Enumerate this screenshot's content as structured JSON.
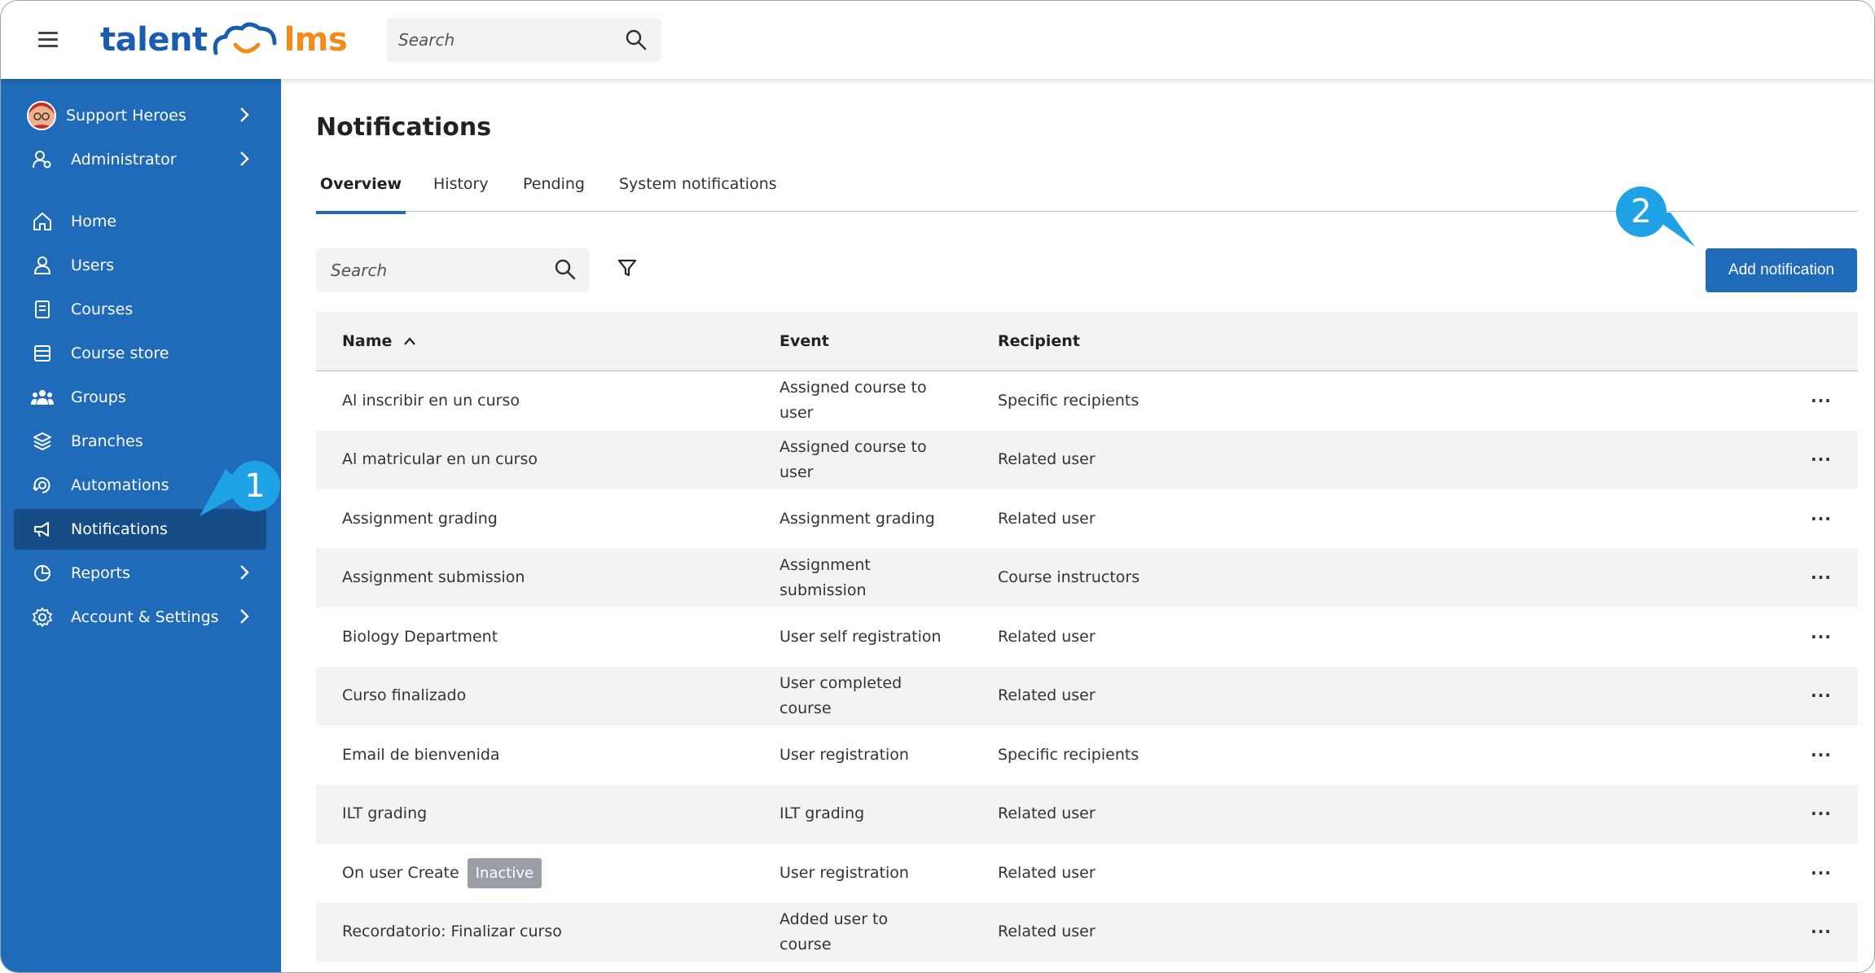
{
  "topbar": {
    "logo_left": "talent",
    "logo_right": "lms",
    "search_placeholder": "Search",
    "icons": [
      "hamburger-icon",
      "search-icon"
    ]
  },
  "sidebar": {
    "profile_items": [
      {
        "label": "Support Heroes",
        "icon": "avatar"
      },
      {
        "label": "Administrator",
        "icon": "user-role-icon"
      }
    ],
    "items": [
      {
        "label": "Home",
        "icon": "home-icon"
      },
      {
        "label": "Users",
        "icon": "user-icon"
      },
      {
        "label": "Courses",
        "icon": "book-icon"
      },
      {
        "label": "Course store",
        "icon": "store-icon"
      },
      {
        "label": "Groups",
        "icon": "groups-icon"
      },
      {
        "label": "Branches",
        "icon": "layers-icon"
      },
      {
        "label": "Automations",
        "icon": "automation-icon"
      },
      {
        "label": "Notifications",
        "icon": "megaphone-icon",
        "active": true
      },
      {
        "label": "Reports",
        "icon": "pie-chart-icon"
      },
      {
        "label": "Account & Settings",
        "icon": "gear-icon"
      }
    ]
  },
  "callouts": {
    "one": "1",
    "two": "2"
  },
  "main": {
    "title": "Notifications",
    "tabs": [
      "Overview",
      "History",
      "Pending",
      "System notifications"
    ],
    "active_tab": "Overview",
    "search_placeholder": "Search",
    "add_button": "Add notification",
    "columns": {
      "name": "Name",
      "event": "Event",
      "recipient": "Recipient"
    },
    "rows": [
      {
        "name": "Al inscribir en un curso",
        "event": "Assigned course to user",
        "recipient": "Specific recipients"
      },
      {
        "name": "Al matricular en un curso",
        "event": "Assigned course to user",
        "recipient": "Related user"
      },
      {
        "name": "Assignment grading",
        "event": "Assignment grading",
        "recipient": "Related user"
      },
      {
        "name": "Assignment submission",
        "event": "Assignment submission",
        "recipient": "Course instructors"
      },
      {
        "name": "Biology Department",
        "event": "User self registration",
        "recipient": "Related user"
      },
      {
        "name": "Curso finalizado",
        "event": "User completed course",
        "recipient": "Related user"
      },
      {
        "name": "Email de bienvenida",
        "event": "User registration",
        "recipient": "Specific recipients"
      },
      {
        "name": "ILT grading",
        "event": "ILT grading",
        "recipient": "Related user"
      },
      {
        "name": "On user Create",
        "badge": "Inactive",
        "event": "User registration",
        "recipient": "Related user"
      },
      {
        "name": "Recordatorio: Finalizar curso",
        "event": "Added user to course",
        "recipient": "Related user"
      }
    ],
    "more_label": "···"
  },
  "colors": {
    "sidebar": "#1f6ab9",
    "sidebar_active": "#164d87",
    "accent": "#1f6ab9",
    "logo_orange": "#f28a1c",
    "callout": "#1fa3e6"
  }
}
